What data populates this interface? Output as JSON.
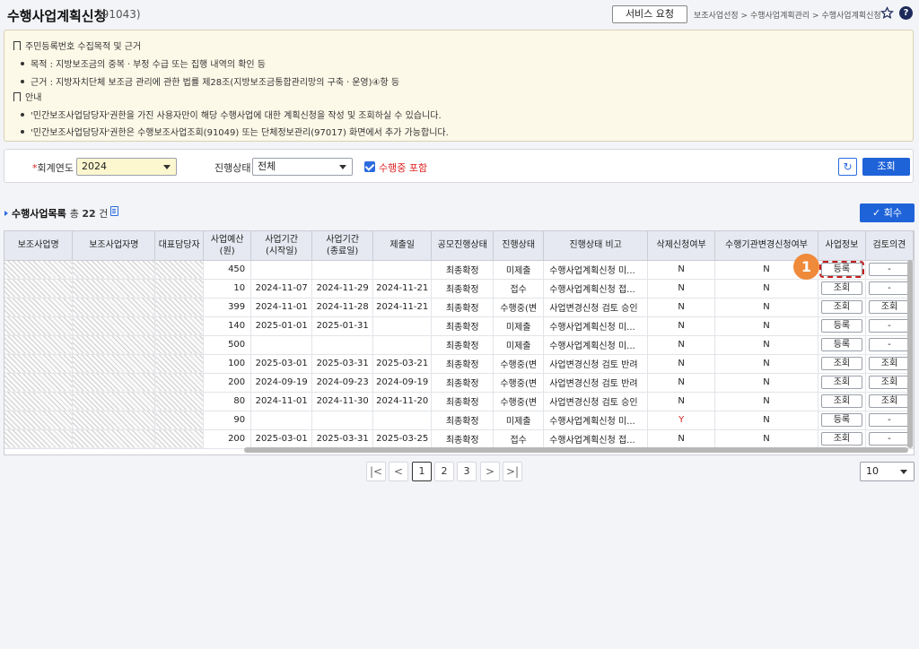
{
  "header": {
    "title": "수행사업계획신청",
    "code": "(91043)",
    "service_button": "서비스 요청",
    "breadcrumb": "보조사업선정 > 수행사업계획관리 > 수행사업계획신청"
  },
  "notice": {
    "section1_title": "주민등록번호 수집목적 및 근거",
    "section1_items": [
      "목적 : 지방보조금의 중복ㆍ부정 수급 또는 집행 내역의 확인 등",
      "근거 : 지방자치단체 보조금 관리에 관한 법률 제28조(지방보조금통합관리망의 구축ㆍ운영)④항 등"
    ],
    "section2_title": "안내",
    "section2_items": [
      "'민간보조사업담당자'권한을 가진 사용자만이 해당 수행사업에 대한 계획신청을 작성 및 조회하실 수 있습니다.",
      "'민간보조사업담당자'권한은 수행보조사업조회(91049) 또는 단체정보관리(97017) 화면에서 추가 가능합니다."
    ]
  },
  "search": {
    "year_label_req": "*",
    "year_label": "회계연도",
    "year_value": "2024",
    "status_label": "진행상태",
    "status_value": "전체",
    "include_label": "수행중 포함",
    "search_button": "조회"
  },
  "list": {
    "title": "수행사업목록",
    "count_prefix": "총",
    "count": "22",
    "count_suffix": "건",
    "recall_button": "회수",
    "columns": [
      "보조사업명",
      "보조사업자명",
      "대표담당자",
      "사업예산\n(원)",
      "사업기간\n(시작일)",
      "사업기간\n(종료일)",
      "제출일",
      "공모진행상태",
      "진행상태",
      "진행상태 비고",
      "삭제신청여부",
      "수행기관변경신청여부",
      "사업정보",
      "검토의견"
    ],
    "rows": [
      {
        "budget": "450",
        "start": "",
        "end": "",
        "submit": "",
        "contest": "최종확정",
        "status": "미제출",
        "note": "수행사업계획신청 미...",
        "del": "N",
        "change": "N",
        "info": "등록",
        "review": "-"
      },
      {
        "budget": "10",
        "start": "2024-11-07",
        "end": "2024-11-29",
        "submit": "2024-11-21",
        "contest": "최종확정",
        "status": "접수",
        "note": "수행사업계획신청 접...",
        "del": "N",
        "change": "N",
        "info": "조회",
        "review": "-"
      },
      {
        "budget": "399",
        "start": "2024-11-01",
        "end": "2024-11-28",
        "submit": "2024-11-21",
        "contest": "최종확정",
        "status": "수행중(변",
        "note": "사업변경신청 검토 승인",
        "del": "N",
        "change": "N",
        "info": "조회",
        "review": "조회"
      },
      {
        "budget": "140",
        "start": "2025-01-01",
        "end": "2025-01-31",
        "submit": "",
        "contest": "최종확정",
        "status": "미제출",
        "note": "수행사업계획신청 미...",
        "del": "N",
        "change": "N",
        "info": "등록",
        "review": "-"
      },
      {
        "budget": "500",
        "start": "",
        "end": "",
        "submit": "",
        "contest": "최종확정",
        "status": "미제출",
        "note": "수행사업계획신청 미...",
        "del": "N",
        "change": "N",
        "info": "등록",
        "review": "-"
      },
      {
        "budget": "100",
        "start": "2025-03-01",
        "end": "2025-03-31",
        "submit": "2025-03-21",
        "contest": "최종확정",
        "status": "수행중(변",
        "note": "사업변경신청 검토 반려",
        "del": "N",
        "change": "N",
        "info": "조회",
        "review": "조회"
      },
      {
        "budget": "200",
        "start": "2024-09-19",
        "end": "2024-09-23",
        "submit": "2024-09-19",
        "contest": "최종확정",
        "status": "수행중(변",
        "note": "사업변경신청 검토 반려",
        "del": "N",
        "change": "N",
        "info": "조회",
        "review": "조회"
      },
      {
        "budget": "80",
        "start": "2024-11-01",
        "end": "2024-11-30",
        "submit": "2024-11-20",
        "contest": "최종확정",
        "status": "수행중(변",
        "note": "사업변경신청 검토 승인",
        "del": "N",
        "change": "N",
        "info": "조회",
        "review": "조회"
      },
      {
        "budget": "90",
        "start": "",
        "end": "",
        "submit": "",
        "contest": "최종확정",
        "status": "미제출",
        "note": "수행사업계획신청 미...",
        "del": "Y",
        "change": "N",
        "info": "등록",
        "review": "-"
      },
      {
        "budget": "200",
        "start": "2025-03-01",
        "end": "2025-03-31",
        "submit": "2025-03-25",
        "contest": "최종확정",
        "status": "접수",
        "note": "수행사업계획신청 접...",
        "del": "N",
        "change": "N",
        "info": "조회",
        "review": "-"
      }
    ]
  },
  "pagination": {
    "first": "|<",
    "prev": "<",
    "pages": [
      "1",
      "2",
      "3"
    ],
    "next": ">",
    "last": ">|",
    "page_size": "10"
  },
  "annotation": {
    "marker": "1"
  },
  "colors": {
    "accent": "#1f63d9",
    "required": "#d22222",
    "marker": "#ef8a3a",
    "highlight": "#c41e1e"
  }
}
